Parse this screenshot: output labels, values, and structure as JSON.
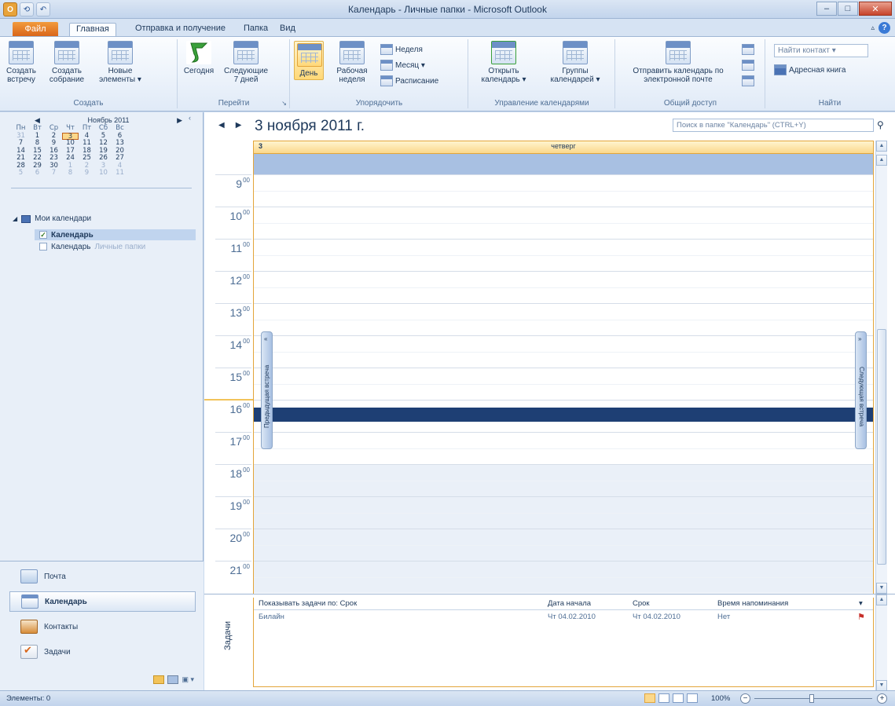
{
  "window": {
    "title": "Календарь - Личные папки - Microsoft Outlook",
    "app_icon": "O",
    "qat_icons": [
      "save-icon",
      "undo-icon"
    ],
    "controls": [
      "–",
      "□",
      "✕"
    ]
  },
  "ribbon_tabs": {
    "file": "Файл",
    "tabs": [
      "Главная",
      "Отправка и получение",
      "Папка",
      "Вид"
    ],
    "active": "Главная"
  },
  "ribbon": {
    "groups": {
      "create": {
        "label": "Создать",
        "new_appointment": "Создать встречу",
        "new_meeting": "Создать собрание",
        "new_items": "Новые элементы ▾"
      },
      "goto": {
        "label": "Перейти",
        "today": "Сегодня",
        "next7": "Следующие 7 дней"
      },
      "arrange": {
        "label": "Упорядочить",
        "day": "День",
        "workweek": "Рабочая неделя",
        "week": "Неделя",
        "month": "Месяц ▾",
        "schedule": "Расписание"
      },
      "manage": {
        "label": "Управление календарями",
        "open": "Открыть календарь ▾",
        "groups": "Группы календарей ▾"
      },
      "share": {
        "label": "Общий доступ",
        "email": "Отправить календарь по электронной почте"
      },
      "find": {
        "label": "Найти",
        "contact": "Найти контакт ▾",
        "addressbook": "Адресная книга"
      }
    }
  },
  "minical": {
    "title": "Ноябрь 2011",
    "dows": [
      "Пн",
      "Вт",
      "Ср",
      "Чт",
      "Пт",
      "Сб",
      "Вс"
    ],
    "weeks": [
      [
        "31",
        "1",
        "2",
        "3",
        "4",
        "5",
        "6"
      ],
      [
        "7",
        "8",
        "9",
        "10",
        "11",
        "12",
        "13"
      ],
      [
        "14",
        "15",
        "16",
        "17",
        "18",
        "19",
        "20"
      ],
      [
        "21",
        "22",
        "23",
        "24",
        "25",
        "26",
        "27"
      ],
      [
        "28",
        "29",
        "30",
        "1",
        "2",
        "3",
        "4"
      ],
      [
        "5",
        "6",
        "7",
        "8",
        "9",
        "10",
        "11"
      ]
    ],
    "today": "3"
  },
  "calendars": {
    "group": "Мои календари",
    "items": [
      {
        "label": "Календарь",
        "sub": ""
      },
      {
        "label": "Календарь",
        "sub": "Личные папки"
      }
    ]
  },
  "nav": {
    "mail": "Почта",
    "calendar": "Календарь",
    "contacts": "Контакты",
    "tasks": "Задачи"
  },
  "main": {
    "date_title": "3 ноября 2011 г.",
    "search_placeholder": "Поиск в папке \"Календарь\" (CTRL+Y)",
    "day_num": "3",
    "day_name": "четверг",
    "hours": [
      "9",
      "10",
      "11",
      "12",
      "13",
      "14",
      "15",
      "16",
      "17",
      "18",
      "19",
      "20",
      "21"
    ],
    "minutes": "00",
    "prev_appt": "Предыдущая встреча",
    "next_appt": "Следующая встреча"
  },
  "tasks_pane": {
    "label": "Задачи",
    "head": {
      "show_by": "Показывать задачи по: Срок",
      "start": "Дата начала",
      "due": "Срок",
      "reminder": "Время напоминания"
    },
    "rows": [
      {
        "subject": "Билайн",
        "start": "Чт 04.02.2010",
        "due": "Чт 04.02.2010",
        "reminder": "Нет"
      }
    ]
  },
  "status": {
    "items": "Элементы: 0",
    "zoom": "100%"
  }
}
